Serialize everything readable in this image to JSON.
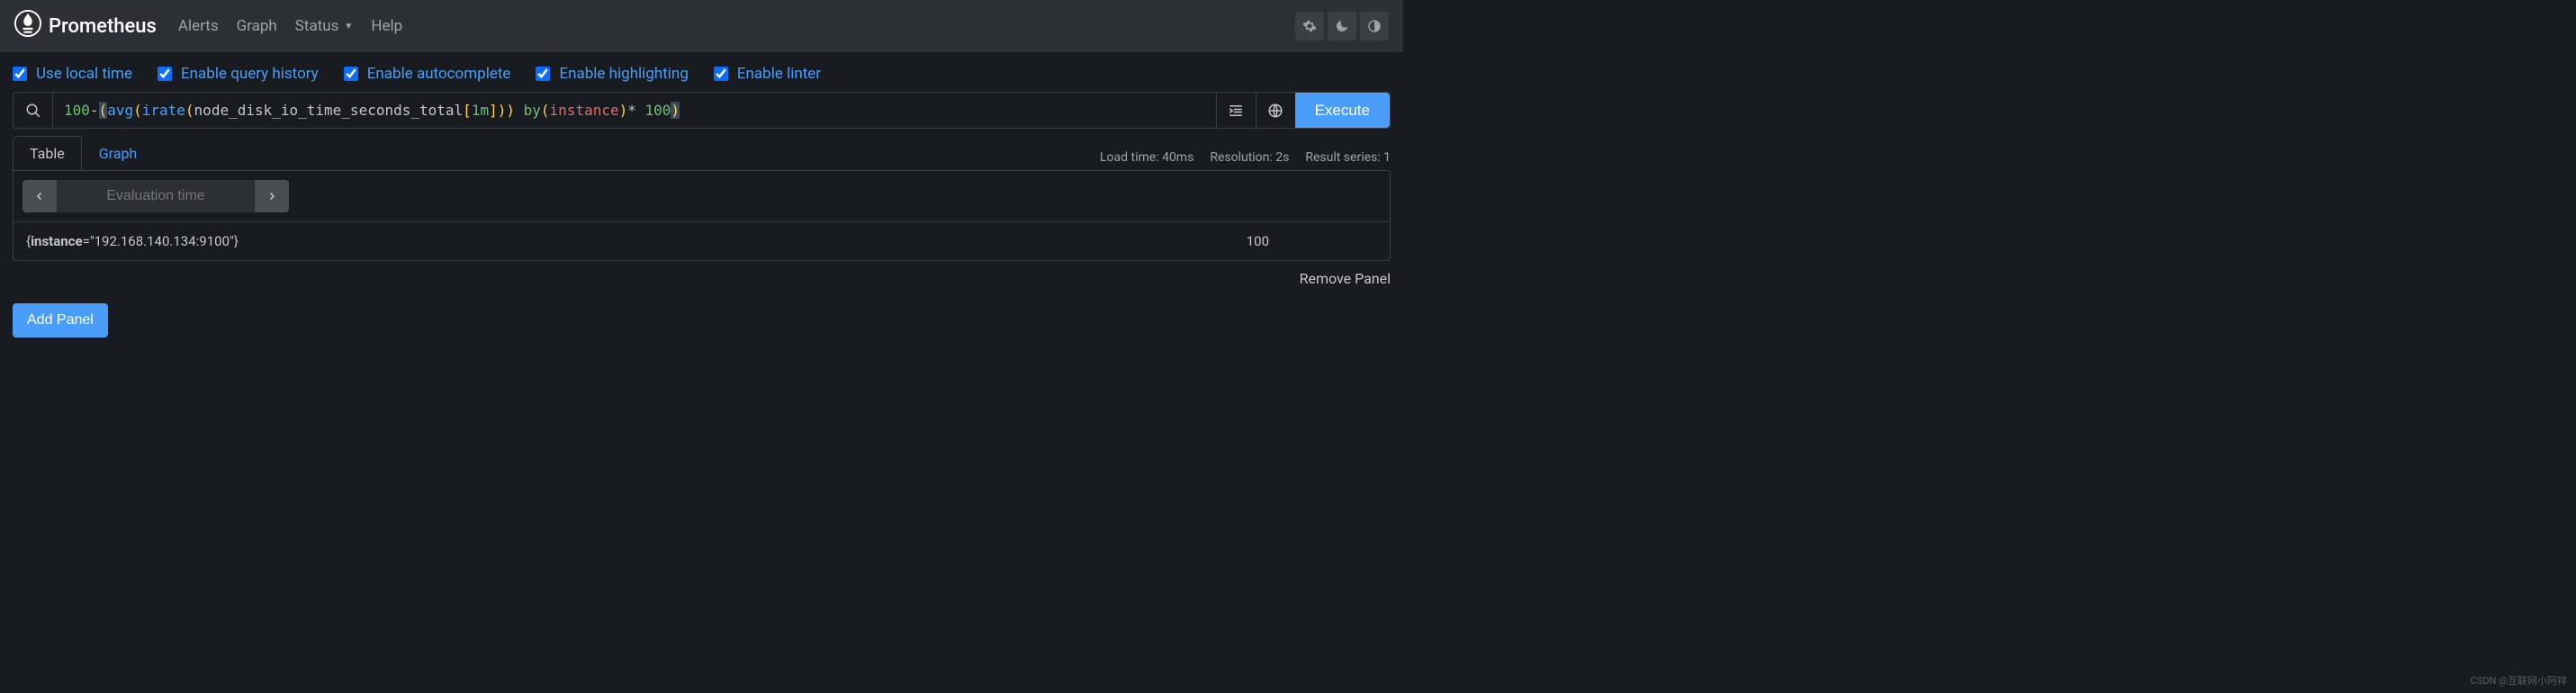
{
  "brand": "Prometheus",
  "nav": {
    "alerts": "Alerts",
    "graph": "Graph",
    "status": "Status",
    "help": "Help"
  },
  "options": {
    "use_local_time": "Use local time",
    "enable_query_history": "Enable query history",
    "enable_autocomplete": "Enable autocomplete",
    "enable_highlighting": "Enable highlighting",
    "enable_linter": "Enable linter"
  },
  "query": {
    "tokens": {
      "n100a": "100",
      "minus": "-",
      "op1": "(",
      "avg": "avg",
      "op2": "(",
      "irate": "irate",
      "op3": "(",
      "metric": "node_disk_io_time_seconds_total",
      "ob": "[",
      "dur": "1m",
      "cb": "]",
      "cp1": ")",
      "cp2": ")",
      "sp": " ",
      "by": "by",
      "op4": "(",
      "label": "instance",
      "cp3": ")",
      "star": "* ",
      "n100b": "100",
      "cp4": ")"
    },
    "execute": "Execute"
  },
  "tabs": {
    "table": "Table",
    "graph": "Graph"
  },
  "stats": {
    "load_time": "Load time: 40ms",
    "resolution": "Resolution: 2s",
    "result_series": "Result series: 1"
  },
  "eval": {
    "placeholder": "Evaluation time"
  },
  "result": {
    "instance_key": "instance",
    "instance_val": "=\"192.168.140.134:9100\"}",
    "value": "100"
  },
  "footer": {
    "remove_panel": "Remove Panel",
    "add_panel": "Add Panel"
  },
  "watermark": "CSDN @互联网小阿祥"
}
